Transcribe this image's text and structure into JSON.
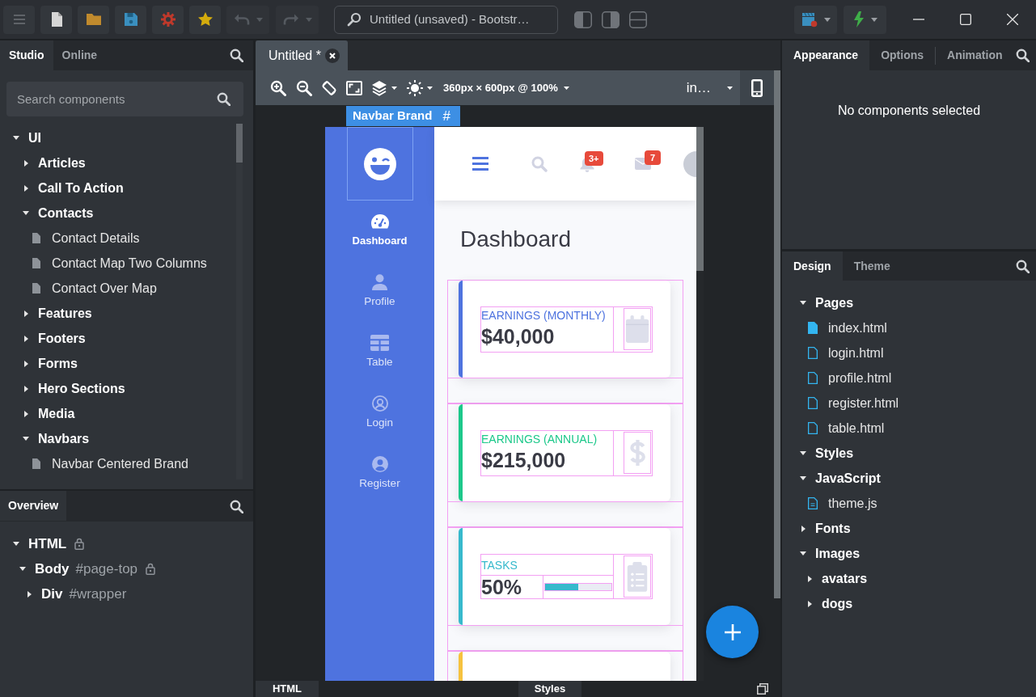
{
  "toolbar": {
    "undo": {
      "disabled": true
    },
    "redo": {
      "disabled": true
    },
    "title": "Untitled (unsaved) - Bootstr…",
    "panel_toggles": [
      {
        "on": true
      },
      {
        "on": true
      },
      {
        "on": false
      }
    ]
  },
  "left_panel": {
    "tabs": [
      {
        "label": "Studio",
        "selected": true
      },
      {
        "label": "Online",
        "selected": false
      }
    ],
    "search": {
      "placeholder": "Search components"
    },
    "tree": [
      {
        "label": "UI",
        "kind": "folder",
        "expanded": true,
        "children": [
          {
            "label": "Articles",
            "kind": "folder",
            "expanded": false
          },
          {
            "label": "Call To Action",
            "kind": "folder",
            "expanded": false
          },
          {
            "label": "Contacts",
            "kind": "folder",
            "expanded": true,
            "children": [
              {
                "label": "Contact Details",
                "kind": "component"
              },
              {
                "label": "Contact Map Two Columns",
                "kind": "component"
              },
              {
                "label": "Contact Over Map",
                "kind": "component"
              }
            ]
          },
          {
            "label": "Features",
            "kind": "folder",
            "expanded": false
          },
          {
            "label": "Footers",
            "kind": "folder",
            "expanded": false
          },
          {
            "label": "Forms",
            "kind": "folder",
            "expanded": false
          },
          {
            "label": "Hero Sections",
            "kind": "folder",
            "expanded": false
          },
          {
            "label": "Media",
            "kind": "folder",
            "expanded": false
          },
          {
            "label": "Navbars",
            "kind": "folder",
            "expanded": true,
            "children": [
              {
                "label": "Navbar Centered Brand",
                "kind": "component"
              }
            ]
          }
        ]
      }
    ]
  },
  "overview": {
    "tabs": [
      {
        "label": "Overview",
        "selected": true
      }
    ],
    "tree": [
      {
        "tag": "HTML",
        "locked": true,
        "expanded": true,
        "children": [
          {
            "tag": "Body",
            "id": "#page-top",
            "locked": true,
            "expanded": true,
            "children": [
              {
                "tag": "Div",
                "id": "#wrapper",
                "locked": false,
                "expanded": false
              }
            ]
          }
        ]
      }
    ]
  },
  "editor": {
    "tabs": [
      {
        "label": "Untitled *",
        "selected": true
      }
    ],
    "toolbar": {
      "viewport": "360px × 600px @ 100%",
      "page": "in…"
    },
    "selection": {
      "label": "Navbar Brand",
      "marker": "#"
    },
    "preview": {
      "sidebar": {
        "items": [
          {
            "label": "Dashboard",
            "selected": true
          },
          {
            "label": "Profile",
            "selected": false
          },
          {
            "label": "Table",
            "selected": false
          },
          {
            "label": "Login",
            "selected": false
          },
          {
            "label": "Register",
            "selected": false
          }
        ]
      },
      "topbar": {
        "alerts_count": "3+",
        "messages_count": "7"
      },
      "heading": "Dashboard",
      "cards": [
        {
          "kind": "stat",
          "label": "EARNINGS (MONTHLY)",
          "value": "$40,000",
          "color": "#4e73df"
        },
        {
          "kind": "stat",
          "label": "EARNINGS (ANNUAL)",
          "value": "$215,000",
          "color": "#1cc88a"
        },
        {
          "kind": "progress",
          "label": "TASKS",
          "value": "50%",
          "level": 0.5,
          "color": "#36b9cc"
        },
        {
          "color": "#f6c23e"
        }
      ]
    },
    "bottom_tabs": [
      {
        "label": "HTML"
      },
      {
        "label": "Styles"
      }
    ]
  },
  "right_panel": {
    "tabs": [
      {
        "label": "Appearance",
        "selected": true
      },
      {
        "label": "Options",
        "selected": false
      },
      {
        "label": "Animation",
        "selected": false
      }
    ],
    "message": "No components selected"
  },
  "design_panel": {
    "tabs": [
      {
        "label": "Design",
        "selected": true
      },
      {
        "label": "Theme",
        "selected": false
      }
    ],
    "tree": [
      {
        "label": "Pages",
        "kind": "folder",
        "expanded": true,
        "children": [
          {
            "label": "index.html",
            "kind": "page",
            "selected": true
          },
          {
            "label": "login.html",
            "kind": "page",
            "selected": false
          },
          {
            "label": "profile.html",
            "kind": "page",
            "selected": false
          },
          {
            "label": "register.html",
            "kind": "page",
            "selected": false
          },
          {
            "label": "table.html",
            "kind": "page",
            "selected": false
          }
        ]
      },
      {
        "label": "Styles",
        "kind": "folder",
        "expanded": true
      },
      {
        "label": "JavaScript",
        "kind": "folder",
        "expanded": true,
        "children": [
          {
            "label": "theme.js",
            "kind": "script",
            "selected": false
          }
        ]
      },
      {
        "label": "Fonts",
        "kind": "folder",
        "expanded": false
      },
      {
        "label": "Images",
        "kind": "folder",
        "expanded": true,
        "children": [
          {
            "label": "avatars",
            "kind": "folder",
            "expanded": false
          },
          {
            "label": "dogs",
            "kind": "folder",
            "expanded": false
          }
        ]
      }
    ]
  }
}
